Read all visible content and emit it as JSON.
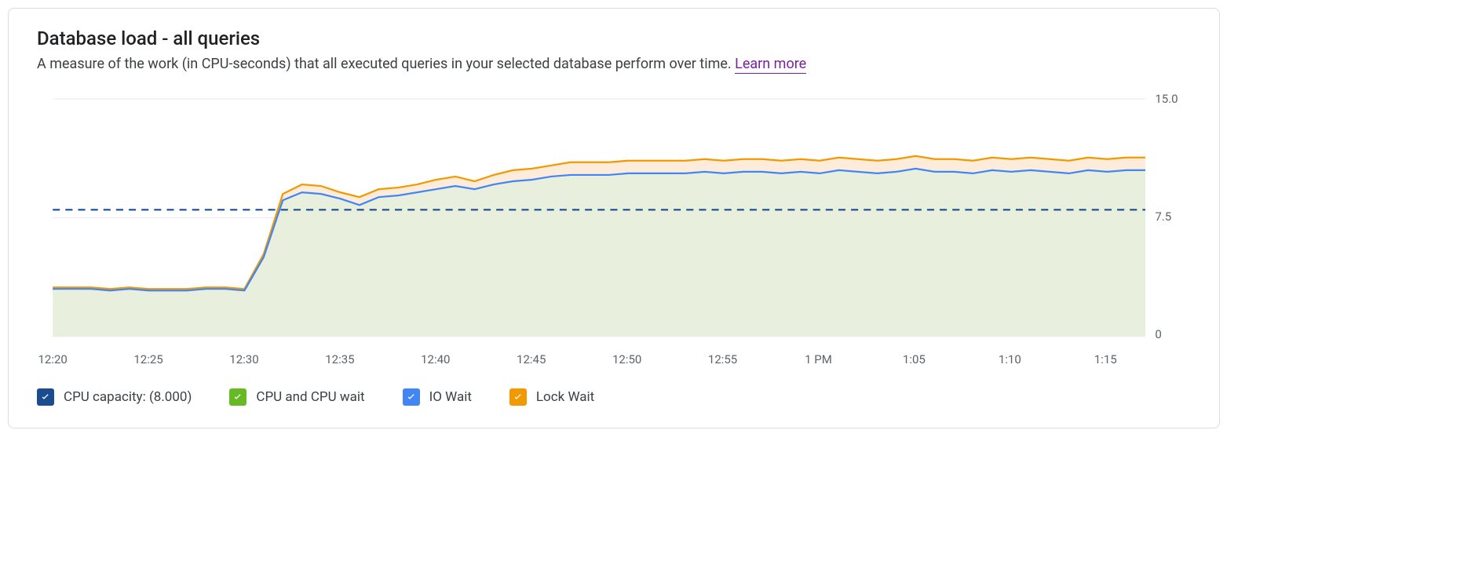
{
  "header": {
    "title": "Database load - all queries",
    "subtitle_prefix": "A measure of the work (in CPU-seconds) that all executed queries in your selected database perform over time. ",
    "learn_more": "Learn more"
  },
  "legend": {
    "cpu_capacity": "CPU capacity: (8.000)",
    "cpu_wait": "CPU and CPU wait",
    "io_wait": "IO Wait",
    "lock_wait": "Lock Wait"
  },
  "colors": {
    "cpu_capacity": "#1a4d8f",
    "cpu_wait_fill": "#e8efdc",
    "cpu_wait_check": "#66bb25",
    "io_wait": "#4285f4",
    "lock_wait": "#f29900",
    "lock_wait_fill": "#fdecd9",
    "grid": "#e8eaed",
    "axis_text": "#5f6368"
  },
  "chart_data": {
    "type": "area",
    "title": "Database load - all queries",
    "xlabel": "",
    "ylabel": "",
    "ylim": [
      0,
      15
    ],
    "y_ticks": [
      0,
      7.5,
      15.0
    ],
    "x_ticks": [
      "12:20",
      "12:25",
      "12:30",
      "12:35",
      "12:40",
      "12:45",
      "12:50",
      "12:55",
      "1 PM",
      "1:05",
      "1:10",
      "1:15"
    ],
    "x_range_minutes": [
      0,
      57
    ],
    "cpu_capacity_line": 8.0,
    "x_minutes": [
      0,
      1,
      2,
      3,
      4,
      5,
      6,
      7,
      8,
      9,
      10,
      11,
      12,
      13,
      14,
      15,
      16,
      17,
      18,
      19,
      20,
      21,
      22,
      23,
      24,
      25,
      26,
      27,
      28,
      29,
      30,
      31,
      32,
      33,
      34,
      35,
      36,
      37,
      38,
      39,
      40,
      41,
      42,
      43,
      44,
      45,
      46,
      47,
      48,
      49,
      50,
      51,
      52,
      53,
      54,
      55,
      56,
      57
    ],
    "series": [
      {
        "name": "CPU and CPU wait",
        "values": [
          3.0,
          3.0,
          3.0,
          2.9,
          3.0,
          2.9,
          2.9,
          2.9,
          3.0,
          3.0,
          2.9,
          5.0,
          8.6,
          9.1,
          9.0,
          8.7,
          8.3,
          8.8,
          8.9,
          9.1,
          9.3,
          9.5,
          9.3,
          9.6,
          9.8,
          9.9,
          10.1,
          10.2,
          10.2,
          10.2,
          10.3,
          10.3,
          10.3,
          10.3,
          10.4,
          10.3,
          10.4,
          10.4,
          10.3,
          10.4,
          10.3,
          10.5,
          10.4,
          10.3,
          10.4,
          10.6,
          10.4,
          10.4,
          10.3,
          10.5,
          10.4,
          10.5,
          10.4,
          10.3,
          10.5,
          10.4,
          10.5,
          10.5
        ]
      },
      {
        "name": "IO Wait",
        "values": [
          0,
          0,
          0,
          0,
          0,
          0,
          0,
          0,
          0,
          0,
          0,
          0,
          0,
          0,
          0,
          0,
          0,
          0,
          0,
          0,
          0,
          0,
          0,
          0,
          0,
          0,
          0,
          0,
          0,
          0,
          0,
          0,
          0,
          0,
          0,
          0,
          0,
          0,
          0,
          0,
          0,
          0,
          0,
          0,
          0,
          0,
          0,
          0,
          0,
          0,
          0,
          0,
          0,
          0,
          0,
          0,
          0,
          0
        ]
      },
      {
        "name": "Lock Wait",
        "values": [
          0.1,
          0.1,
          0.1,
          0.1,
          0.1,
          0.1,
          0.1,
          0.1,
          0.1,
          0.1,
          0.1,
          0.2,
          0.4,
          0.5,
          0.5,
          0.4,
          0.5,
          0.5,
          0.5,
          0.5,
          0.6,
          0.6,
          0.5,
          0.6,
          0.7,
          0.7,
          0.7,
          0.8,
          0.8,
          0.8,
          0.8,
          0.8,
          0.8,
          0.8,
          0.8,
          0.8,
          0.8,
          0.8,
          0.8,
          0.8,
          0.8,
          0.8,
          0.8,
          0.8,
          0.8,
          0.8,
          0.8,
          0.8,
          0.8,
          0.8,
          0.8,
          0.8,
          0.8,
          0.8,
          0.8,
          0.8,
          0.8,
          0.8
        ]
      }
    ]
  }
}
